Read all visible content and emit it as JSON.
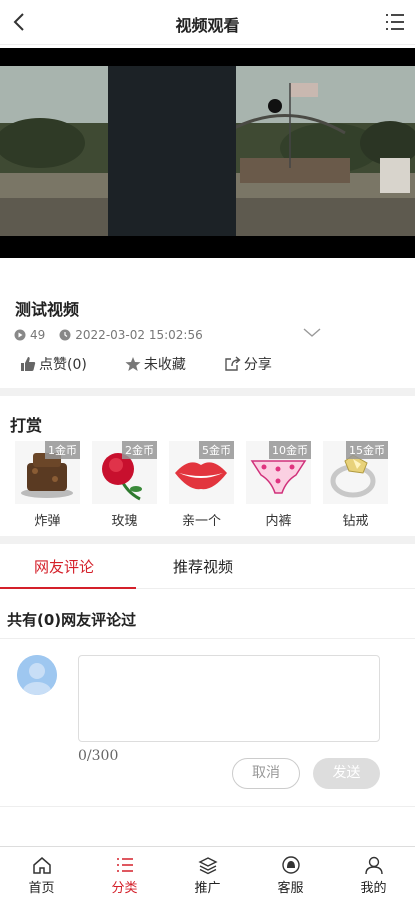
{
  "header": {
    "title": "视频观看",
    "back_icon": "chevron-left-icon",
    "menu_icon": "list-menu-icon"
  },
  "video": {
    "title": "测试视频",
    "views": "49",
    "datetime": "2022-03-02 15:02:56"
  },
  "actions": {
    "like": "点赞(0)",
    "favorite": "未收藏",
    "share": "分享"
  },
  "reward": {
    "title": "打赏",
    "gifts": [
      {
        "name": "炸弹",
        "price": "1金币"
      },
      {
        "name": "玫瑰",
        "price": "2金币"
      },
      {
        "name": "亲一个",
        "price": "5金币"
      },
      {
        "name": "内裤",
        "price": "10金币"
      },
      {
        "name": "钻戒",
        "price": "15金币"
      }
    ]
  },
  "tabs": {
    "comments": "网友评论",
    "recommended": "推荐视频"
  },
  "comments": {
    "count_text": "共有(0)网友评论过",
    "counter": "0/300",
    "cancel": "取消",
    "send": "发送"
  },
  "bottom_nav": {
    "items": [
      {
        "label": "首页",
        "icon": "home-icon"
      },
      {
        "label": "分类",
        "icon": "category-list-icon"
      },
      {
        "label": "推广",
        "icon": "layers-icon"
      },
      {
        "label": "客服",
        "icon": "service-bell-icon"
      },
      {
        "label": "我的",
        "icon": "user-icon"
      }
    ],
    "active_index": 1
  },
  "colors": {
    "accent": "#d4202a",
    "muted": "#777777",
    "divider": "#f1f1f1"
  }
}
